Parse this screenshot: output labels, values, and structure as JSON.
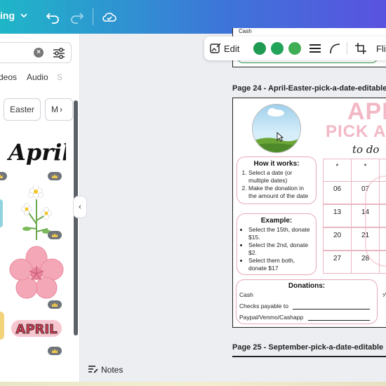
{
  "topbar": {
    "mode_label": "ing",
    "icons": [
      "chevron-down-icon",
      "undo-icon",
      "redo-icon",
      "cloud-saved-icon"
    ]
  },
  "side_panel": {
    "search": {
      "value": "",
      "clear_icon": "clear-icon",
      "filter_icon": "filter-icon"
    },
    "tabs": [
      "deos",
      "Audio",
      "S"
    ],
    "chips": [
      "Easter",
      "M"
    ],
    "elements": [
      {
        "name": "april-script-sticker",
        "text": "April"
      },
      {
        "name": "daisy-flowers-sticker"
      },
      {
        "name": "pink-blossom-sticker"
      },
      {
        "name": "april-banner-sticker",
        "text": "APRIL"
      }
    ],
    "collapse_icon": "chevron-left-icon"
  },
  "context_toolbar": {
    "edit_label": "Edit",
    "colors": [
      "#1e9a52",
      "#22a35a",
      "#3fae55"
    ],
    "flip_label": "Flip",
    "icons": [
      "edit-image-icon",
      "lines-icon",
      "curve-icon",
      "crop-icon"
    ]
  },
  "pages": {
    "prev_text": "Cash",
    "page24_title": "Page 24 - April-Easter-pick-a-date-editable",
    "page25_title": "Page 25 - September-pick-a-date-editable"
  },
  "worksheet": {
    "title_line1": "APRI",
    "title_line2": "PICK A",
    "title_line3": "to do",
    "how_it_works_title": "How it works:",
    "how_it_works_items": [
      "Select a date (or multiple dates)",
      "Make the donation in the amount of the date"
    ],
    "example_title": "Example:",
    "example_items": [
      "Select the 15th, donate $15.",
      "Select the 2nd, donate $2.",
      "Select them both, donate $17"
    ],
    "donations_title": "Donations:",
    "donation_lines": [
      "Cash",
      "Checks payable to",
      "Paypal/Venmo/Cashapp"
    ],
    "grid": [
      [
        "*",
        "*"
      ],
      [
        "06",
        "07"
      ],
      [
        "13",
        "14"
      ],
      [
        "20",
        "21"
      ],
      [
        "27",
        "28"
      ]
    ]
  },
  "footer": {
    "notes_label": "Notes",
    "notes_icon": "notes-icon"
  }
}
